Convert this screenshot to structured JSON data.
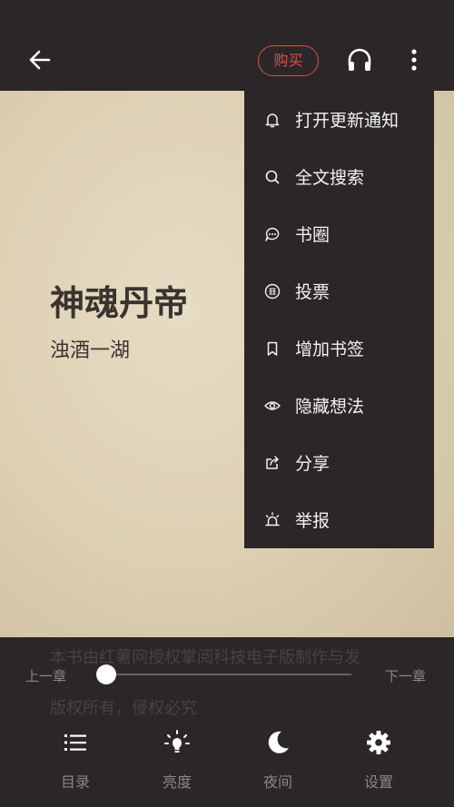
{
  "header": {
    "back_icon": "arrow-left-icon",
    "buy_label": "购买",
    "headphone_icon": "headphone-icon",
    "more_icon": "more-vertical-icon",
    "accent": "#e0504a"
  },
  "book": {
    "title": "神魂丹帝",
    "author": "浊酒一湖",
    "ghost_line_1": "本书由红薯网授权掌阅科技电子版制作与发",
    "ghost_line_2": "版权所有，侵权必究"
  },
  "menu": {
    "items": [
      {
        "label": "打开更新通知",
        "icon": "bell-icon"
      },
      {
        "label": "全文搜索",
        "icon": "search-icon"
      },
      {
        "label": "书圈",
        "icon": "chat-bubble-icon"
      },
      {
        "label": "投票",
        "icon": "vote-icon"
      },
      {
        "label": "增加书签",
        "icon": "bookmark-icon"
      },
      {
        "label": "隐藏想法",
        "icon": "eye-icon"
      },
      {
        "label": "分享",
        "icon": "share-icon"
      },
      {
        "label": "举报",
        "icon": "alarm-icon"
      }
    ]
  },
  "progress": {
    "prev_label": "上一章",
    "next_label": "下一章",
    "value": 0
  },
  "bottom_nav": {
    "items": [
      {
        "label": "目录",
        "icon": "list-icon"
      },
      {
        "label": "亮度",
        "icon": "brightness-icon"
      },
      {
        "label": "夜间",
        "icon": "moon-icon"
      },
      {
        "label": "设置",
        "icon": "gear-icon"
      }
    ]
  }
}
